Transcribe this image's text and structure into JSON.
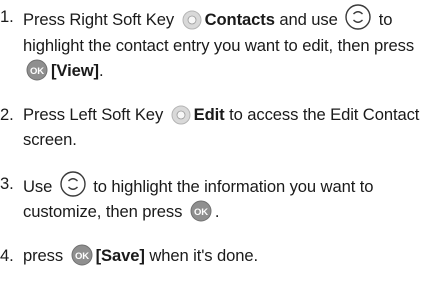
{
  "steps": [
    {
      "number": "1.",
      "t1": "Press Right Soft Key",
      "b1": "Contacts",
      "t2": "and use",
      "t3": "to highlight the contact entry you want to edit, then press",
      "b2": "[View]",
      "t4": "."
    },
    {
      "number": "2.",
      "t1": "Press Left Soft Key",
      "b1": "Edit",
      "t2": "to access the Edit Contact screen."
    },
    {
      "number": "3.",
      "t1": "Use",
      "t2": "to highlight the information you want to customize, then press",
      "t3": "."
    },
    {
      "number": "4.",
      "t1": "press",
      "b1": "[Save]",
      "t2": "when it's done."
    }
  ],
  "icons": {
    "soft_key": "soft-key-icon",
    "nav_key": "navigation-key-icon",
    "ok_key": "ok-key-icon",
    "ok_label": "OK"
  }
}
